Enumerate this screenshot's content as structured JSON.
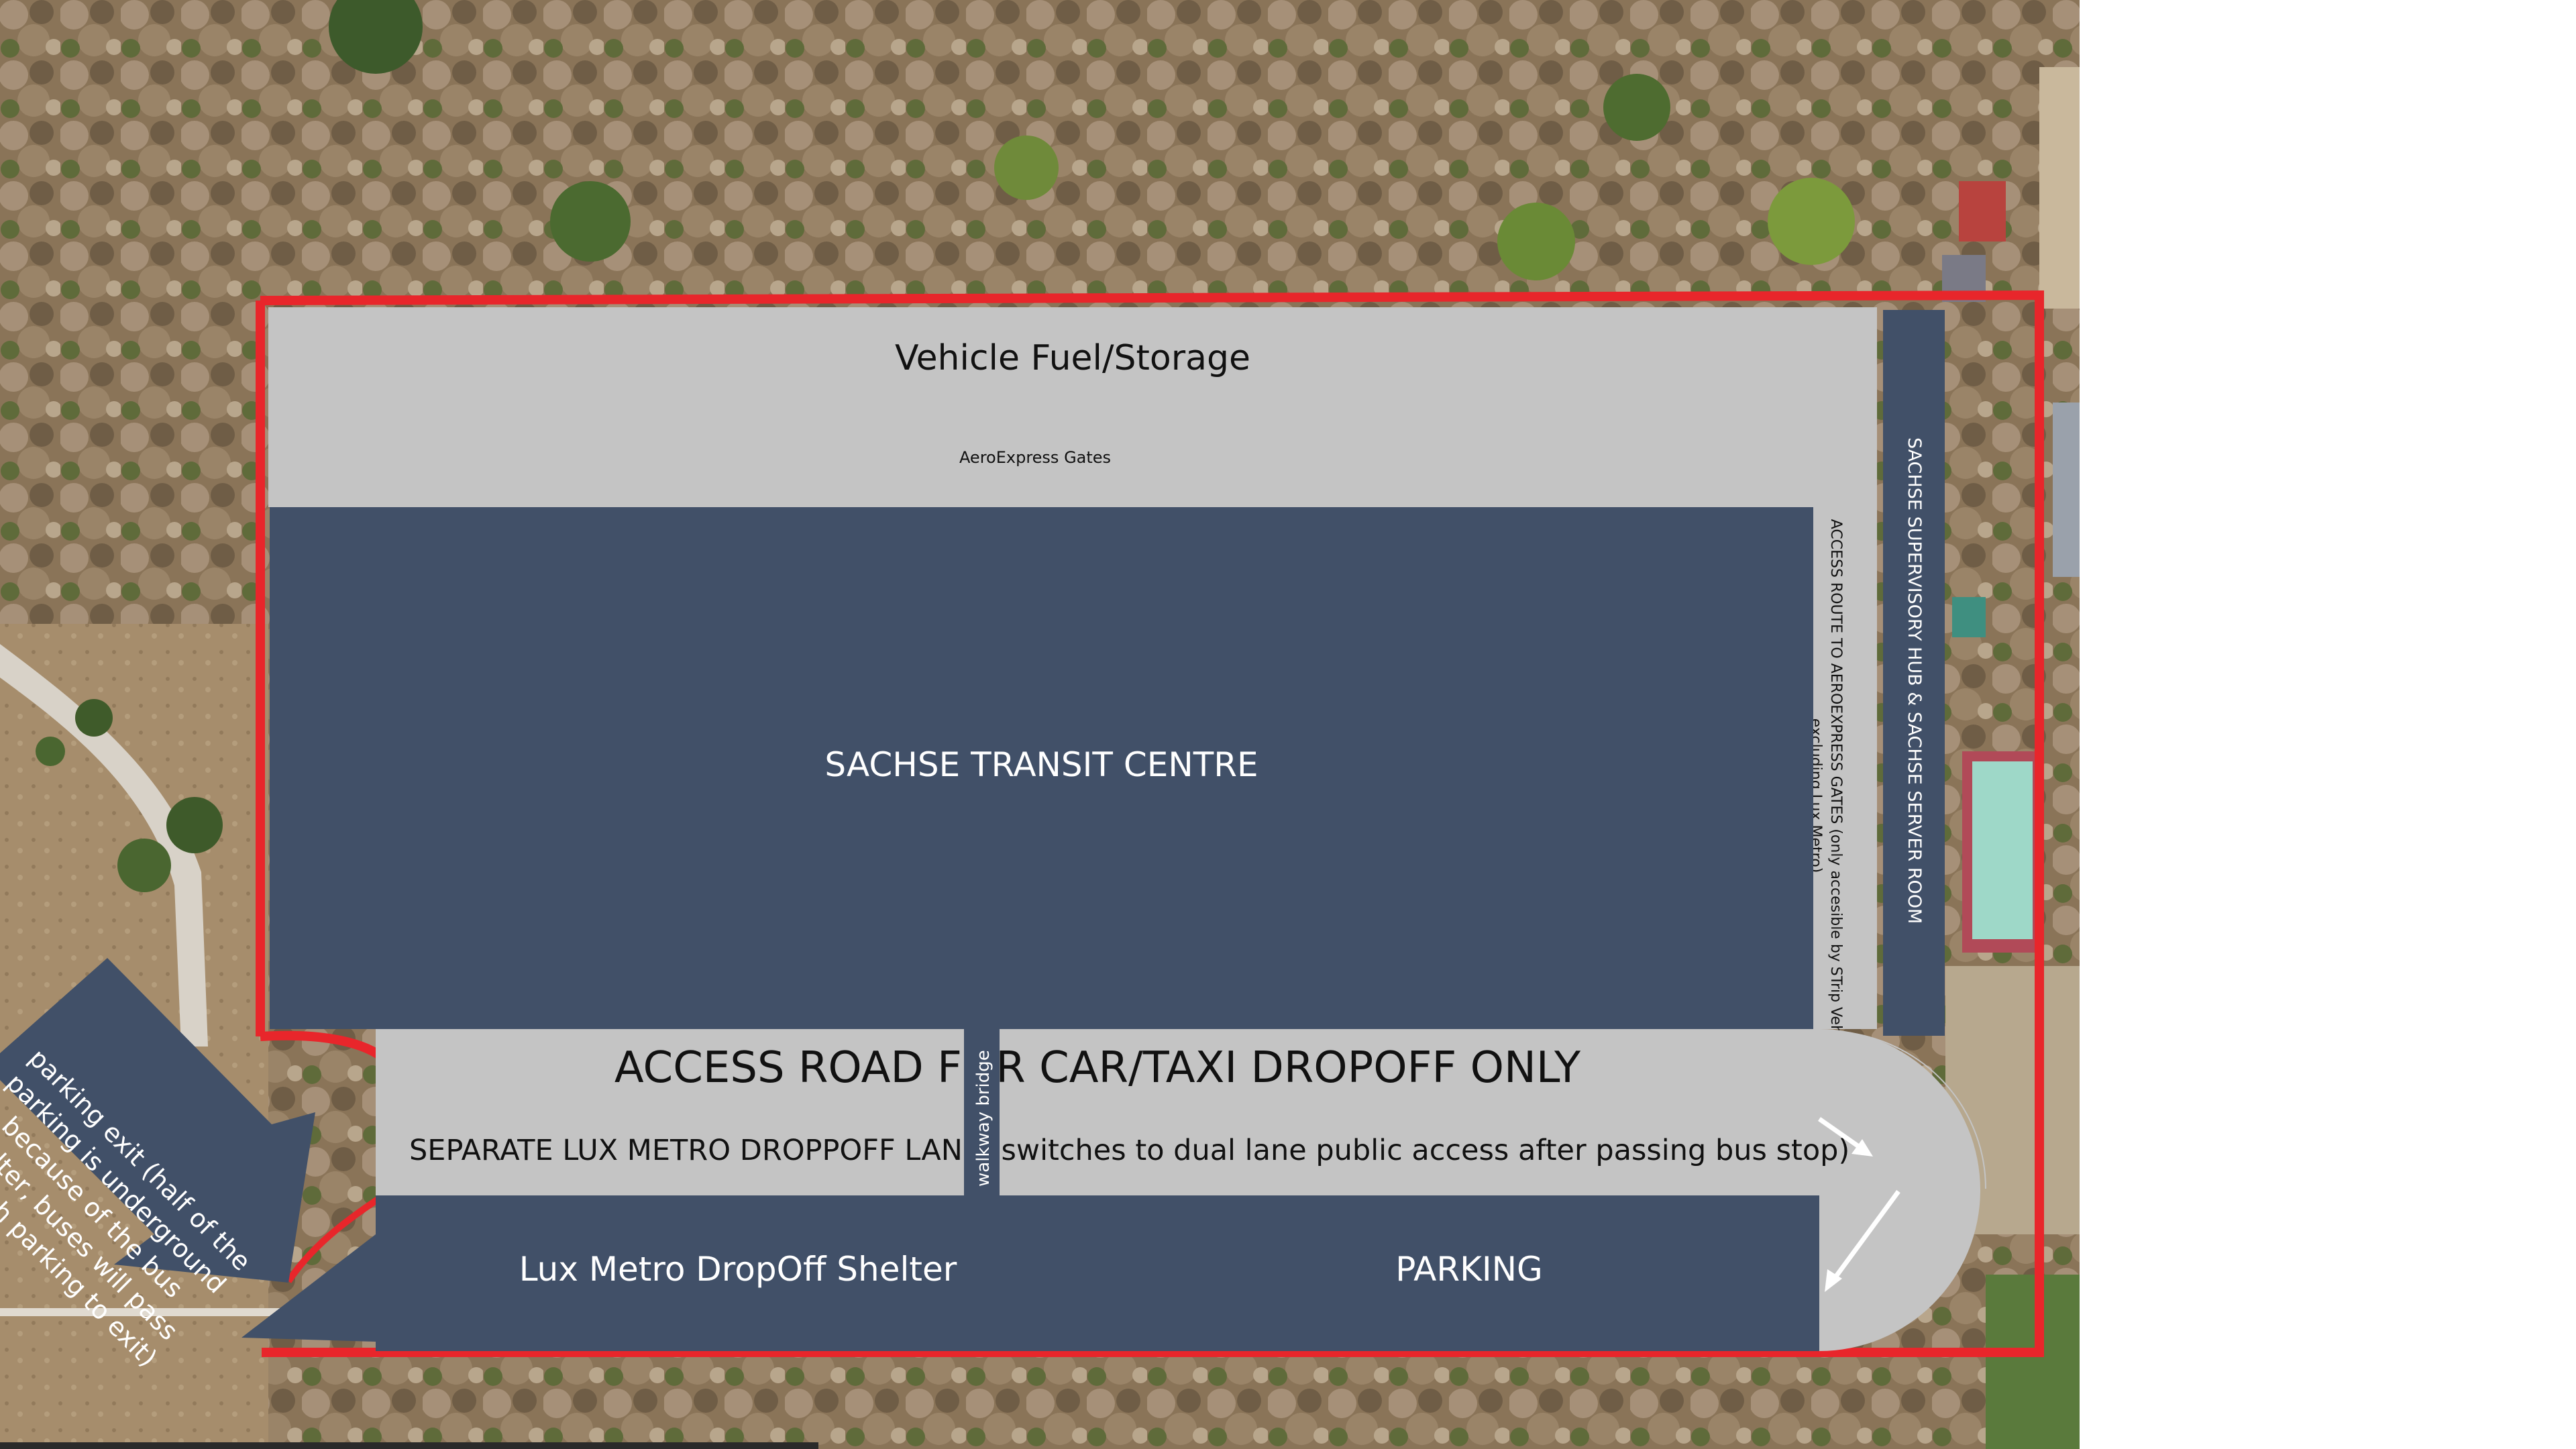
{
  "site": {
    "fuel_storage": "Vehicle Fuel/Storage",
    "aeroexpress_gates": "AeroExpress Gates",
    "transit_centre": "SACHSE TRANSIT CENTRE",
    "access_route": "ACCESS ROUTE TO AEROEXPRESS GATES (only accesible by STrip Vehicles, excluding Lux Metro)",
    "supervisory_hub": "SACHSE SUPERVISORY HUB & SACHSE SERVER ROOM",
    "access_road": "ACCESS ROAD FOR CAR/TAXI DROPOFF ONLY",
    "walkway_bridge": "walkway bridge",
    "separate_lane": "SEPARATE LUX METRO DROPPOFF LANE (switches to dual lane public access after passing bus stop)",
    "lux_shelter": "Lux Metro DropOff Shelter",
    "parking": "PARKING",
    "parking_exit_note": "parking exit (half of the parking is underground because of the bus shelter, buses will pass through parking to exit)"
  },
  "colors": {
    "boundary": "#e8262b",
    "grey_zone": "#c4c4c4",
    "navy_zone": "#415068",
    "text_light": "#ffffff",
    "text_dark": "#111111"
  }
}
